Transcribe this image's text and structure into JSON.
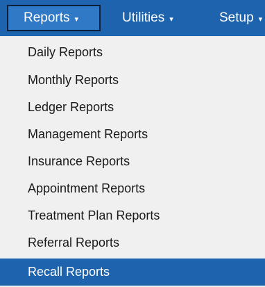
{
  "colors": {
    "menubar_bg": "#1d63ad",
    "active_tab_bg": "#2f79c7",
    "dropdown_bg": "#f0f0f0",
    "selected_bg": "#1d63ad"
  },
  "menubar": {
    "reports_label": "Reports",
    "utilities_label": "Utilities",
    "setup_label": "Setup",
    "caret": "▾"
  },
  "dropdown": {
    "items": [
      {
        "label": "Daily Reports"
      },
      {
        "label": "Monthly Reports"
      },
      {
        "label": "Ledger Reports"
      },
      {
        "label": "Management Reports"
      },
      {
        "label": "Insurance Reports"
      },
      {
        "label": "Appointment Reports"
      },
      {
        "label": "Treatment Plan Reports"
      },
      {
        "label": "Referral Reports"
      },
      {
        "label": "Recall Reports"
      }
    ],
    "selected_index": 8
  }
}
